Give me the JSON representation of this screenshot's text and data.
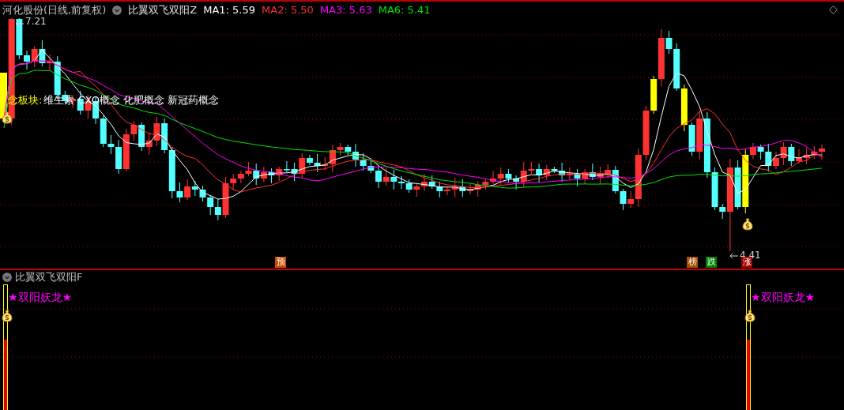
{
  "header": {
    "stock": "河化股份(日线,前复权)",
    "indicator": "比翼双飞双阳Z",
    "ma": [
      {
        "label": "MA1: 5.59",
        "color": "#ffffff"
      },
      {
        "label": "MA2: 5.50",
        "color": "#ff3232"
      },
      {
        "label": "MA3: 5.63",
        "color": "#ff00ff"
      },
      {
        "label": "MA6: 5.41",
        "color": "#00e600"
      }
    ]
  },
  "main_chart": {
    "high_label": "7.21",
    "low_label": "4.41",
    "concept_label": "念板块:",
    "concepts": "维生素 CXO概念 化肥概念 新冠药概念",
    "markers": [
      {
        "text": "预",
        "color": "#c84a00"
      },
      {
        "text": "榜",
        "color": "#a05000"
      },
      {
        "text": "跌",
        "color": "#008000"
      },
      {
        "text": "涨",
        "color": "#a00000"
      }
    ]
  },
  "sub_chart": {
    "title": "比翼双飞双阳F",
    "signals": [
      "★双阳妖龙★",
      "★双阳妖龙★"
    ]
  }
}
